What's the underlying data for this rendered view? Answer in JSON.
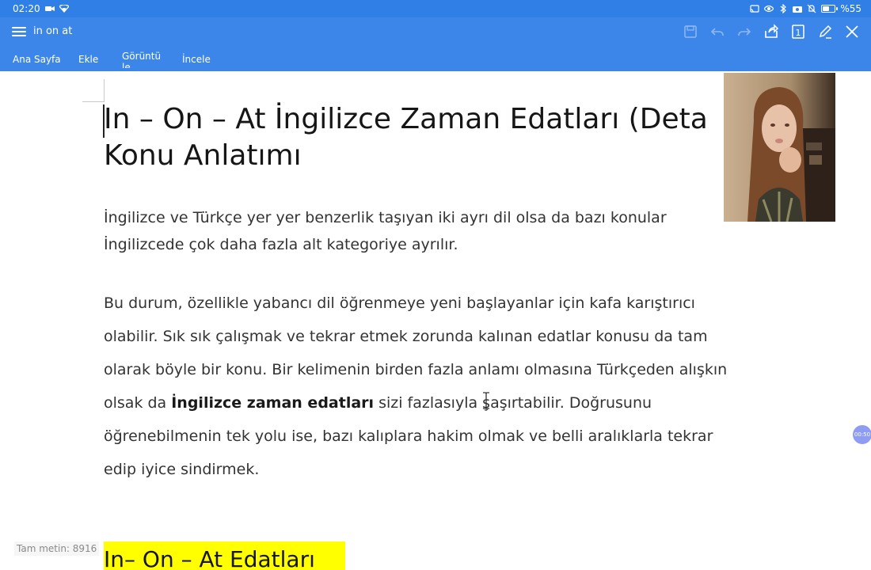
{
  "status_bar": {
    "time": "02:20",
    "battery_text": "%55",
    "battery_level": 0.55,
    "icons": [
      "video-icon",
      "wifi-icon",
      "cast-icon",
      "eye-icon",
      "bluetooth-icon",
      "camera-icon",
      "mute-icon",
      "battery-icon"
    ]
  },
  "toolbar": {
    "doc_title": "in on at",
    "icons": [
      "menu-icon",
      "save-icon",
      "undo-icon",
      "redo-icon",
      "share-icon",
      "page-count-icon",
      "edit-icon",
      "close-icon"
    ],
    "page_count": "1"
  },
  "tabs": [
    {
      "label": "Ana Sayfa"
    },
    {
      "label": "Ekle"
    },
    {
      "label": "Görüntüle"
    },
    {
      "label": "İncele"
    }
  ],
  "document": {
    "heading_line1": "In – On – At İngilizce Zaman Edatları (Deta",
    "heading_line2": "Konu Anlatımı",
    "para1_line1": "İngilizce ve Türkçe yer yer benzerlik taşıyan iki ayrı dil olsa da bazı konular",
    "para1_line2": "İngilizcede çok daha fazla alt kategoriye ayrılır.",
    "para2_line1": "Bu durum, özellikle yabancı dil öğrenmeye yeni başlayanlar için kafa karıştırıcı",
    "para2_line2": "olabilir. Sık sık çalışmak ve tekrar etmek zorunda kalınan edatlar konusu da tam",
    "para2_line3": "olarak böyle bir konu. Bir kelimenin birden fazla anlamı olmasına Türkçeden alışkın",
    "para2_line4_pre": "olsak da ",
    "para2_line4_bold": "İngilizce zaman edatları",
    "para2_line4_post": " sizi fazlasıyla şaşırtabilir. Doğrusunu",
    "para2_line5": "öğrenebilmenin tek yolu ise, bazı kalıplara hakim olmak ve belli aralıklarla tekrar",
    "para2_line6": "edip iyice sindirmek.",
    "heading2": "In– On – At Edatları",
    "heading2_highlight": "#ffff00"
  },
  "footer": {
    "word_count": "Tam metin: 8916"
  },
  "float_bubble": {
    "label": "00:50"
  },
  "colors": {
    "status_bar": "#2f7fe6",
    "app_bar": "#3c86ea",
    "highlight": "#ffff00"
  }
}
